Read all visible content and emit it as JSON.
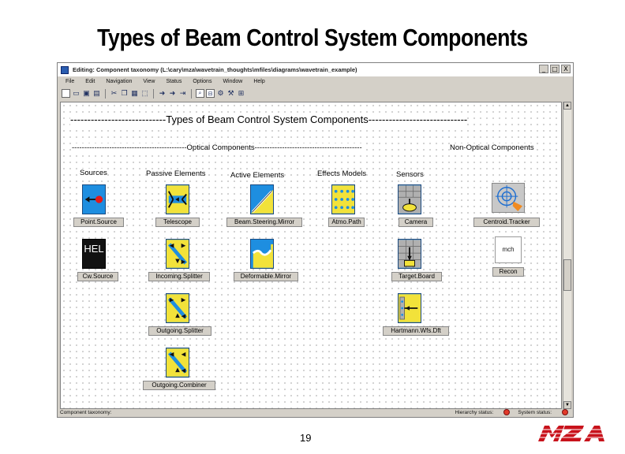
{
  "slide": {
    "title": "Types of Beam Control System Components",
    "page_number": "19",
    "logo_text": "MZA"
  },
  "window": {
    "title": "Editing: Component taxonomy (L:\\cary\\mza\\wavetrain_thoughts\\mfiles\\diagrams\\wavetrain_example)",
    "controls": [
      "_",
      "□",
      "X"
    ],
    "menu": [
      "File",
      "Edit",
      "Navigation",
      "View",
      "Status",
      "Options",
      "Window",
      "Help"
    ]
  },
  "diagram": {
    "heading": "----------------------------Types of Beam Control System Components-----------------------------",
    "optical_heading": "----------------------------------------------Optical Components-------------------------------------------",
    "non_optical_heading": "Non-Optical Components",
    "columns": {
      "sources": "Sources",
      "passive": "Passive Elements",
      "active": "Active Elements",
      "effects": "Effects Models",
      "sensors": "Sensors"
    },
    "components": {
      "point_source": "Point.Source",
      "telescope": "Telescope",
      "beam_steering_mirror": "Beam.Steering.Mirror",
      "atmo_path": "Atmo.Path",
      "camera": "Camera",
      "centroid_tracker": "Centroid.Tracker",
      "cw_source": "Cw.Source",
      "hel_text": "HEL",
      "incoming_splitter": "Incoming.Splitter",
      "deformable_mirror": "Deformable.Mirror",
      "target_board": "Target.Board",
      "recon": "Recon",
      "recon_text": "mch",
      "outgoing_splitter": "Outgoing.Splitter",
      "hartmann_wfs_dft": "Hartmann.Wfs.Dft",
      "outgoing_combiner": "Outgoing.Combiner"
    }
  },
  "statusbar": {
    "left": "Component taxonomy:",
    "hierarchy_status": "Hierarchy status:",
    "system_status": "System status:"
  },
  "colors": {
    "icon_blue": "#1e8ee0",
    "icon_yellow": "#f2e23a",
    "status_red": "#e23a2a",
    "logo_red": "#c8121b"
  },
  "icons": [
    "save-icon",
    "print-icon",
    "cut-icon",
    "copy-icon",
    "paste-icon",
    "zoom-icon",
    "run-icon",
    "wrench-icon"
  ]
}
